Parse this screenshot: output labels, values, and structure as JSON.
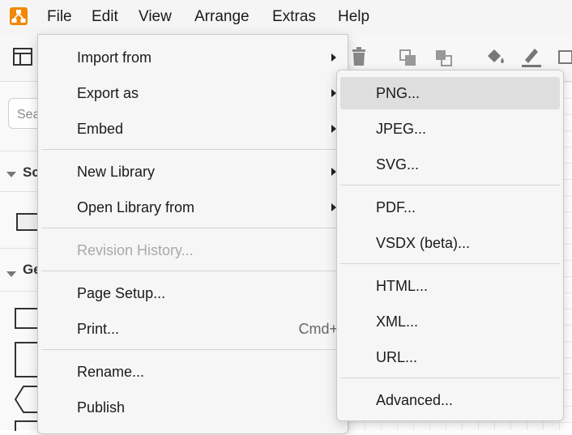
{
  "colors": {
    "accent": "#f08705",
    "menu_bg": "#f6f6f6",
    "highlight": "#dedede",
    "disabled": "#a9a9a9"
  },
  "menubar": {
    "logo_icon": "drawio-logo-icon",
    "items": [
      "File",
      "Edit",
      "View",
      "Arrange",
      "Extras",
      "Help"
    ]
  },
  "toolbar": {
    "icons": [
      "format-panel-icon",
      "delete-icon",
      "to-front-icon",
      "to-back-icon",
      "fill-color-icon",
      "line-color-icon",
      "shadow-icon"
    ]
  },
  "sidebar": {
    "search_placeholder": "Sea",
    "sections": [
      "Sc",
      "Ge"
    ]
  },
  "file_menu": {
    "items": [
      {
        "label": "Import from",
        "submenu": true
      },
      {
        "label": "Export as",
        "submenu": true
      },
      {
        "label": "Embed",
        "submenu": true
      },
      {
        "label": "New Library",
        "submenu": true
      },
      {
        "label": "Open Library from",
        "submenu": true
      },
      {
        "label": "Revision History...",
        "disabled": true
      },
      {
        "label": "Page Setup..."
      },
      {
        "label": "Print...",
        "shortcut": "Cmd+P"
      },
      {
        "label": "Rename..."
      },
      {
        "label": "Publish"
      }
    ]
  },
  "export_submenu": {
    "items": [
      "PNG...",
      "JPEG...",
      "SVG...",
      "PDF...",
      "VSDX (beta)...",
      "HTML...",
      "XML...",
      "URL...",
      "Advanced..."
    ],
    "highlighted": "PNG..."
  }
}
